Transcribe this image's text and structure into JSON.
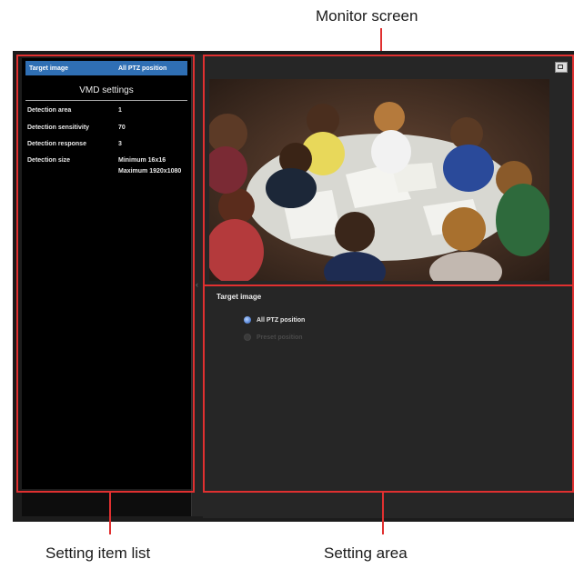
{
  "callouts": {
    "monitor_screen": "Monitor screen",
    "setting_item_list": "Setting item list",
    "setting_area": "Setting area"
  },
  "setting_list": {
    "selected_item": {
      "label": "Target image",
      "value": "All PTZ position"
    },
    "section_title": "VMD settings",
    "rows": [
      {
        "label": "Detection area",
        "value": "1"
      },
      {
        "label": "Detection sensitivity",
        "value": "70"
      },
      {
        "label": "Detection response",
        "value": "3"
      },
      {
        "label": "Detection size",
        "value": "Minimum 16x16"
      }
    ],
    "detection_size_max": "Maximum 1920x1080"
  },
  "setting_area": {
    "title": "Target image",
    "options": [
      {
        "label": "All PTZ position",
        "selected": true
      },
      {
        "label": "Preset position",
        "selected": false
      }
    ]
  },
  "colors": {
    "annotation_red": "#e03030",
    "selected_blue": "#2f6fb4",
    "panel_dark": "#000000",
    "pane_dark": "#262626"
  },
  "icons": {
    "fullscreen": "fullscreen-icon"
  }
}
